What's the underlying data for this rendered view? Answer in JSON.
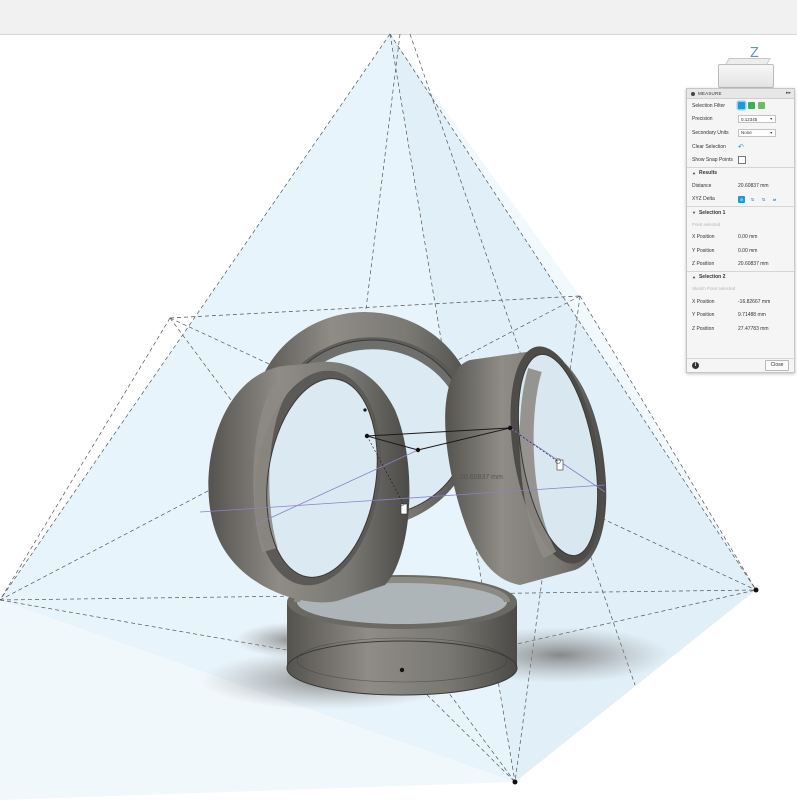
{
  "viewcube": {
    "axis_label": "Z"
  },
  "measure": {
    "title": "MEASURE",
    "selection_filter_label": "Selection Filter",
    "precision_label": "Precision",
    "precision_value": "0.12345",
    "secondary_units_label": "Secondary Units",
    "secondary_units_value": "None",
    "clear_selection_label": "Clear Selection",
    "show_snap_points_label": "Show Snap Points",
    "results": {
      "header": "Results",
      "distance_label": "Distance",
      "distance_value": "20.60837 mm",
      "xyz_delta_label": "XYZ Delta"
    },
    "selection1": {
      "header": "Selection 1",
      "placeholder": "Point selected",
      "x_label": "X Position",
      "x_value": "0.00 mm",
      "y_label": "Y Position",
      "y_value": "0.00 mm",
      "z_label": "Z Position",
      "z_value": "20.60837 mm"
    },
    "selection2": {
      "header": "Selection 2",
      "placeholder": "Sketch Point selected",
      "x_label": "X Position",
      "x_value": "-16.82667 mm",
      "y_label": "Y Position",
      "y_value": "9.71488 mm",
      "z_label": "Z Position",
      "z_value": "27.47783 mm"
    },
    "close_label": "Close"
  },
  "canvas": {
    "measure_label": "20.60837 mm"
  },
  "colors": {
    "accent": "#1a9ad6",
    "projection": "#d6ebf7",
    "ring_metal": "#7a7873"
  }
}
